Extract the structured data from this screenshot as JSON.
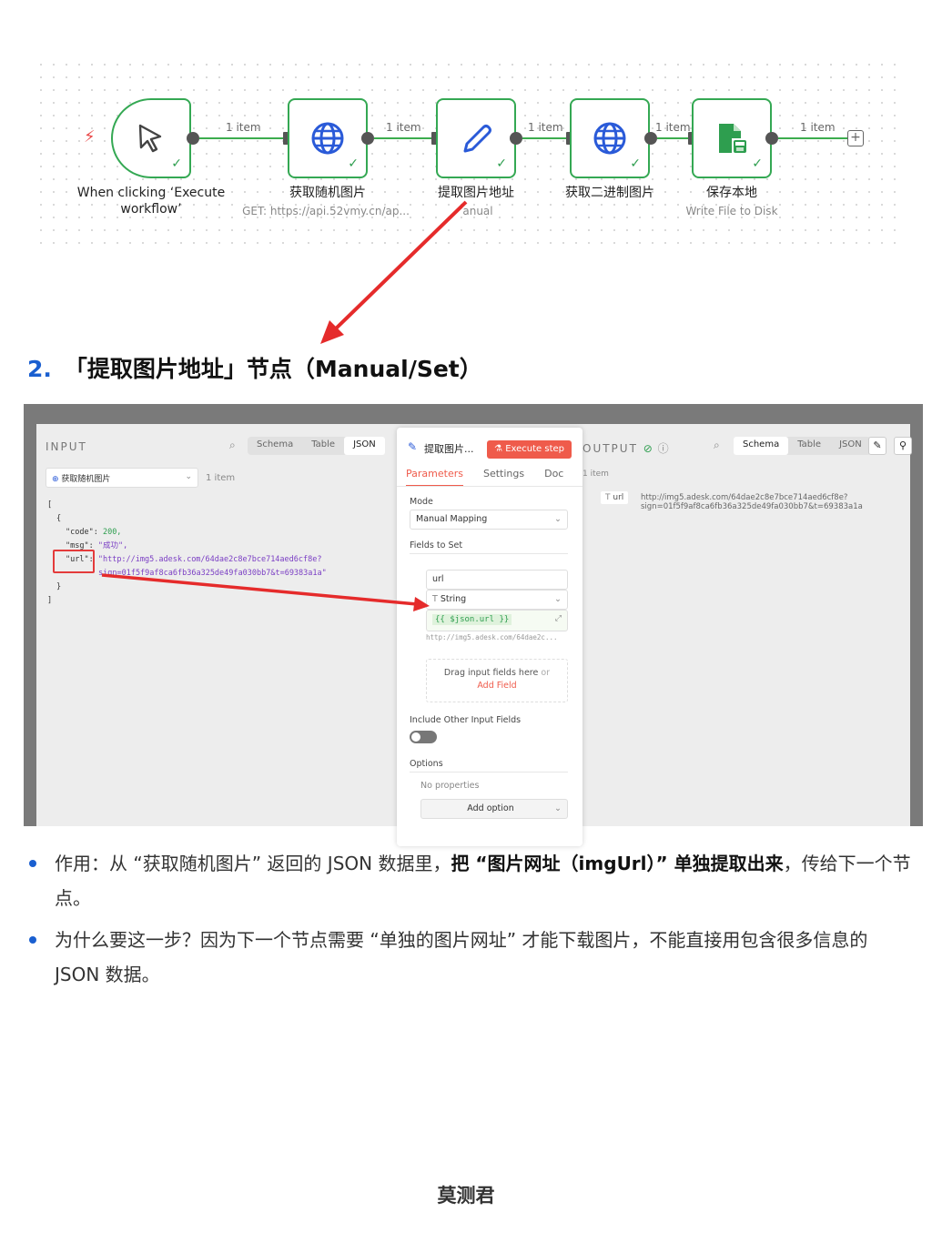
{
  "workflow": {
    "nodes": [
      {
        "title_line1": "When clicking ‘Execute",
        "title_line2": "workflow’",
        "sub": "",
        "icon": "cursor-icon"
      },
      {
        "title_line1": "获取随机图片",
        "sub": "GET: https://api.52vmy.cn/ap...",
        "icon": "globe-icon"
      },
      {
        "title_line1": "提取图片地址",
        "sub": "anual",
        "icon": "pencil-icon"
      },
      {
        "title_line1": "获取二进制图片",
        "sub": "",
        "icon": "globe-icon"
      },
      {
        "title_line1": "保存本地",
        "sub": "Write File to Disk",
        "icon": "file-disk-icon"
      }
    ],
    "edge_labels": [
      "1 item",
      "1 item",
      "1 item",
      "1 item",
      "1 item"
    ]
  },
  "heading": {
    "number": "2.",
    "text": "「提取图片地址」节点（Manual/Set）"
  },
  "screenshot": {
    "input": {
      "label": "INPUT",
      "tabs": [
        "Schema",
        "Table",
        "JSON"
      ],
      "active_tab": "JSON",
      "node_select": "获取随机图片",
      "item_count": "1 item",
      "json_lines": {
        "open_bracket": "[",
        "open_brace": "{",
        "code_key": "\"code\":",
        "code_val": "200,",
        "msg_key": "\"msg\":",
        "msg_val": "\"成功\",",
        "url_key": "\"url\":",
        "url_val_1": "\"http://img5.adesk.com/64dae2c8e7bce714aed6cf8e?",
        "url_val_2": "sign=01f5f9af8ca6fb36a325de49fa030bb7&t=69383a1a\"",
        "close_brace": "}",
        "close_bracket": "]"
      }
    },
    "dialog": {
      "title": "提取图片...",
      "execute_label": "Execute step",
      "tabs": [
        "Parameters",
        "Settings",
        "Doc"
      ],
      "mode_label": "Mode",
      "mode_value": "Manual Mapping",
      "fields_label": "Fields to Set",
      "field_name": "url",
      "field_type": "String",
      "field_expr": "{{ $json.url }}",
      "field_preview": "http://img5.adesk.com/64dae2c...",
      "drag_text": "Drag input fields here",
      "drag_or": "or",
      "add_field": "Add Field",
      "include_label": "Include Other Input Fields",
      "options_label": "Options",
      "no_props": "No properties",
      "add_option": "Add option"
    },
    "output": {
      "label": "OUTPUT",
      "tabs": [
        "Schema",
        "Table",
        "JSON"
      ],
      "active_tab": "Schema",
      "item_count": "1 item",
      "field_key": "url",
      "field_val_1": "http://img5.adesk.com/64dae2c8e7bce714aed6cf8e?",
      "field_val_2": "sign=01f5f9af8ca6fb36a325de49fa030bb7&t=69383a1a"
    }
  },
  "bullets": {
    "b1_pre": "作用：从 “获取随机图片” 返回的 JSON 数据里，",
    "b1_bold": "把 “图片网址（imgUrl）” 单独提取出来",
    "b1_post": "，传给下一个节点。",
    "b2": "为什么要这一步？因为下一个节点需要 “单独的图片网址” 才能下载图片，不能直接用包含很多信息的 JSON 数据。"
  },
  "signature": "莫测君",
  "colors": {
    "accent_green": "#34a853",
    "accent_red": "#ef5b4b",
    "heading_blue": "#1a5fd0"
  }
}
